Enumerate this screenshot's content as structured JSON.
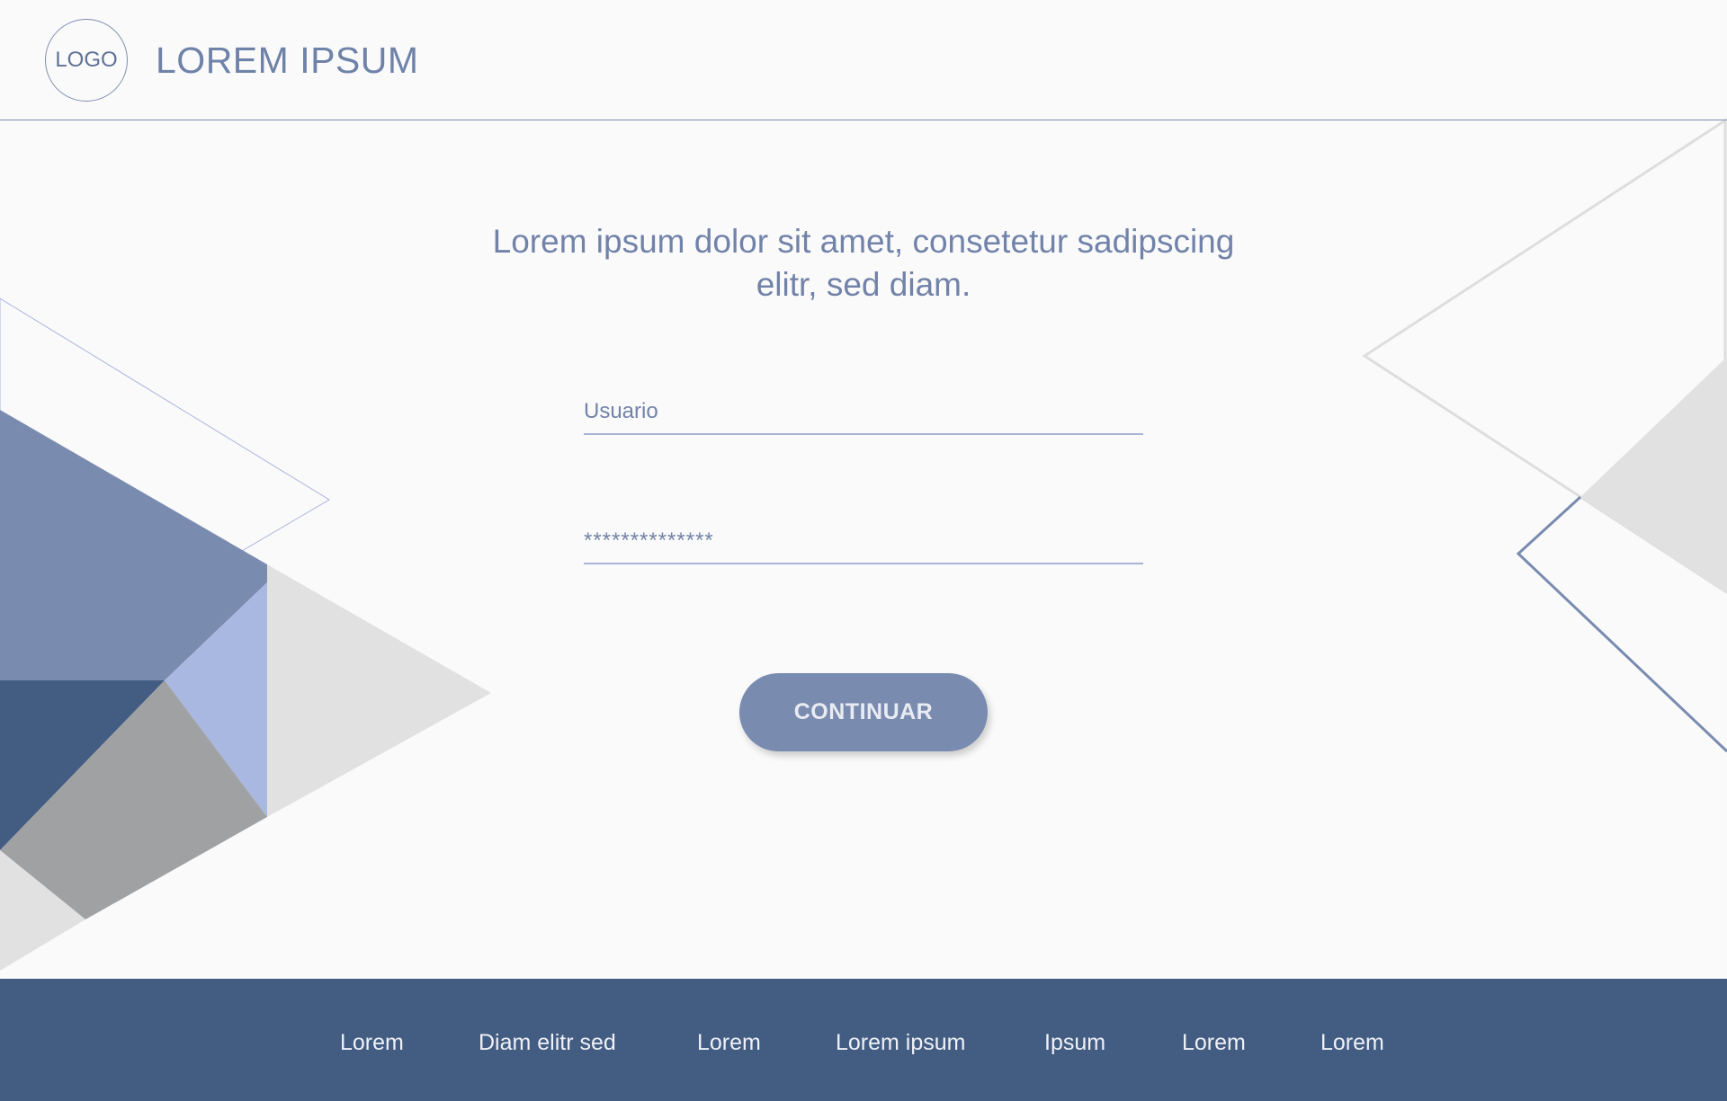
{
  "header": {
    "logo_label": "LOGO",
    "brand_title": "LOREM IPSUM"
  },
  "main": {
    "headline_line1": "Lorem ipsum dolor sit amet, consetetur sadipscing",
    "headline_line2": "elitr, sed diam.",
    "username_placeholder": "Usuario",
    "password_placeholder": "**************",
    "continue_label": "CONTINUAR"
  },
  "footer": {
    "links": [
      "Lorem",
      "Diam elitr sed",
      "Lorem",
      "Lorem ipsum",
      "Ipsum",
      "Lorem",
      "Lorem"
    ]
  },
  "colors": {
    "primary": "#7a8bb0",
    "footer_bg": "#435c82",
    "accent_light": "#a7b4d6",
    "neutral_gray": "#a0a1a3",
    "light_gray": "#e1e1e1",
    "background": "#fafafa"
  }
}
